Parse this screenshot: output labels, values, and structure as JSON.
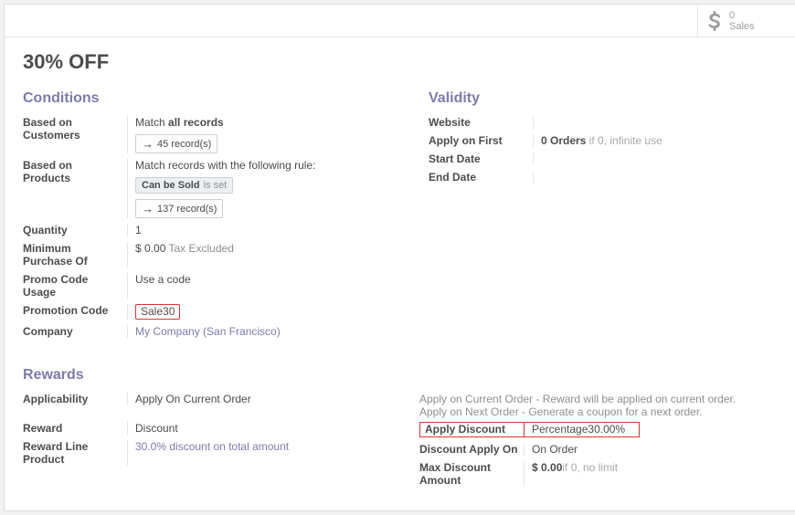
{
  "ribbon": {
    "count": "0",
    "label": "Sales"
  },
  "title": "30% OFF",
  "conditions": {
    "heading": "Conditions",
    "basedOnCustomers": {
      "label": "Based on Customers",
      "match": "Match",
      "all": "all records",
      "records": "45 record(s)"
    },
    "basedOnProducts": {
      "label": "Based on Products",
      "match": "Match records with the following rule:",
      "rule1": "Can be Sold",
      "rule2": "is set",
      "records": "137 record(s)"
    },
    "quantity": {
      "label": "Quantity",
      "value": "1"
    },
    "minPurchase": {
      "label": "Minimum Purchase Of",
      "value": "$ 0.00",
      "sub": "Tax Excluded"
    },
    "promoUsage": {
      "label": "Promo Code Usage",
      "value": "Use a code"
    },
    "promoCode": {
      "label": "Promotion Code",
      "value": "Sale30"
    },
    "company": {
      "label": "Company",
      "value": "My Company (San Francisco)"
    }
  },
  "validity": {
    "heading": "Validity",
    "website": {
      "label": "Website",
      "value": ""
    },
    "applyFirst": {
      "label": "Apply on First",
      "value": "0 Orders",
      "hint": "if 0, infinite use"
    },
    "startDate": {
      "label": "Start Date",
      "value": ""
    },
    "endDate": {
      "label": "End Date",
      "value": ""
    }
  },
  "rewards": {
    "heading": "Rewards",
    "applicability": {
      "label": "Applicability",
      "value": "Apply On Current Order"
    },
    "descCurrent": {
      "strong": "Apply on Current Order -",
      "text": " Reward will be applied on current order."
    },
    "descNext": {
      "strong": "Apply on Next Order -",
      "text": " Generate a coupon for a next order."
    },
    "reward": {
      "label": "Reward",
      "value": "Discount"
    },
    "rewardLine": {
      "label": "Reward Line Product",
      "value": "30.0% discount on total amount"
    },
    "applyDiscount": {
      "label": "Apply Discount",
      "value": "Percentage",
      "pct": "30.00%"
    },
    "discountOn": {
      "label": "Discount Apply On",
      "value": "On Order"
    },
    "maxDiscount": {
      "label": "Max Discount Amount",
      "value": "$ 0.00",
      "hint": "if 0, no limit"
    }
  }
}
